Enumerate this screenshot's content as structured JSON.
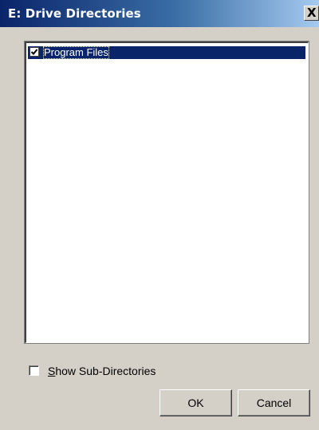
{
  "window": {
    "title": "E: Drive Directories",
    "close_glyph": "X"
  },
  "directory_list": {
    "items": [
      {
        "label": "Program Files",
        "checked": true,
        "selected": true
      }
    ]
  },
  "options": {
    "show_subdirs_accel": "S",
    "show_subdirs_rest": "how Sub-Directories",
    "show_subdirs_checked": false
  },
  "buttons": {
    "ok_label": "OK",
    "cancel_label": "Cancel"
  },
  "colors": {
    "face": "#d4d0c8",
    "titlebar_start": "#0a246a",
    "titlebar_end": "#a6caf0",
    "selection": "#0a246a"
  }
}
